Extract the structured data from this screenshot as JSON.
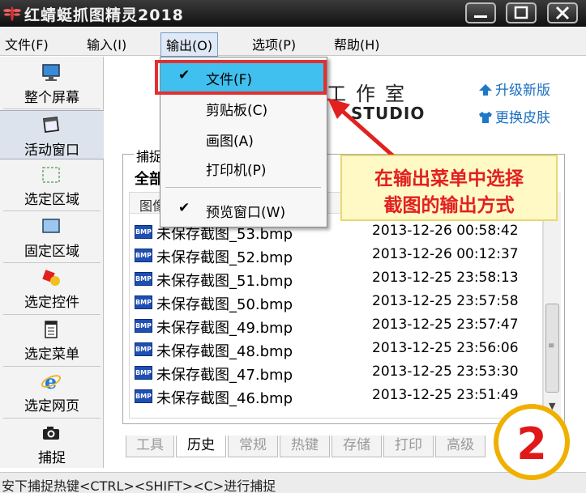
{
  "window": {
    "title": "红蜻蜓抓图精灵2018"
  },
  "menubar": {
    "items": [
      {
        "label": "文件(F)"
      },
      {
        "label": "输入(I)"
      },
      {
        "label": "输出(O)"
      },
      {
        "label": "选项(P)"
      },
      {
        "label": "帮助(H)"
      }
    ]
  },
  "toolbar": {
    "items": [
      {
        "label": "整个屏幕",
        "icon": "monitor-icon"
      },
      {
        "label": "活动窗口",
        "icon": "window-icon"
      },
      {
        "label": "选定区域",
        "icon": "dashed-region-icon"
      },
      {
        "label": "固定区域",
        "icon": "fixed-region-icon"
      },
      {
        "label": "选定控件",
        "icon": "control-icon"
      },
      {
        "label": "选定菜单",
        "icon": "menu-icon"
      },
      {
        "label": "选定网页",
        "icon": "ie-icon"
      },
      {
        "label": "捕捉",
        "icon": "camera-icon"
      }
    ]
  },
  "header": {
    "logo_chinese": "工作室",
    "logo_english": "STUDIO",
    "upgrade_label": "升级新版",
    "skin_label": "更换皮肤"
  },
  "capture_group": {
    "title": "捕捉",
    "subtitle": "全部",
    "column_header": "图像"
  },
  "history": {
    "rows": [
      {
        "name": "未保存截图_53.bmp",
        "date": "2013-12-26 00:58:42"
      },
      {
        "name": "未保存截图_52.bmp",
        "date": "2013-12-26 00:12:37"
      },
      {
        "name": "未保存截图_51.bmp",
        "date": "2013-12-25 23:58:13"
      },
      {
        "name": "未保存截图_50.bmp",
        "date": "2013-12-25 23:57:58"
      },
      {
        "name": "未保存截图_49.bmp",
        "date": "2013-12-25 23:57:47"
      },
      {
        "name": "未保存截图_48.bmp",
        "date": "2013-12-25 23:56:06"
      },
      {
        "name": "未保存截图_47.bmp",
        "date": "2013-12-25 23:53:30"
      },
      {
        "name": "未保存截图_46.bmp",
        "date": "2013-12-25 23:51:49"
      }
    ]
  },
  "tabs": [
    {
      "label": "工具"
    },
    {
      "label": "历史"
    },
    {
      "label": "常规"
    },
    {
      "label": "热键"
    },
    {
      "label": "存储"
    },
    {
      "label": "打印"
    },
    {
      "label": "高级"
    }
  ],
  "status": {
    "text": "安下捕捉热键<CTRL><SHIFT><C>进行捕捉"
  },
  "output_menu": {
    "items": [
      {
        "label": "文件(F)",
        "checked": "✔"
      },
      {
        "label": "剪贴板(C)",
        "checked": ""
      },
      {
        "label": "画图(A)",
        "checked": ""
      },
      {
        "label": "打印机(P)",
        "checked": ""
      },
      {
        "label": "预览窗口(W)",
        "checked": "✔"
      }
    ]
  },
  "annotation": {
    "line1": "在输出菜单中选择",
    "line2": "截图的输出方式",
    "step": "2"
  },
  "colors": {
    "highlight": "#3fc0ef",
    "annotation_red": "#e22020",
    "link_blue": "#1a6fc0",
    "badge_ring": "#f0b000"
  }
}
